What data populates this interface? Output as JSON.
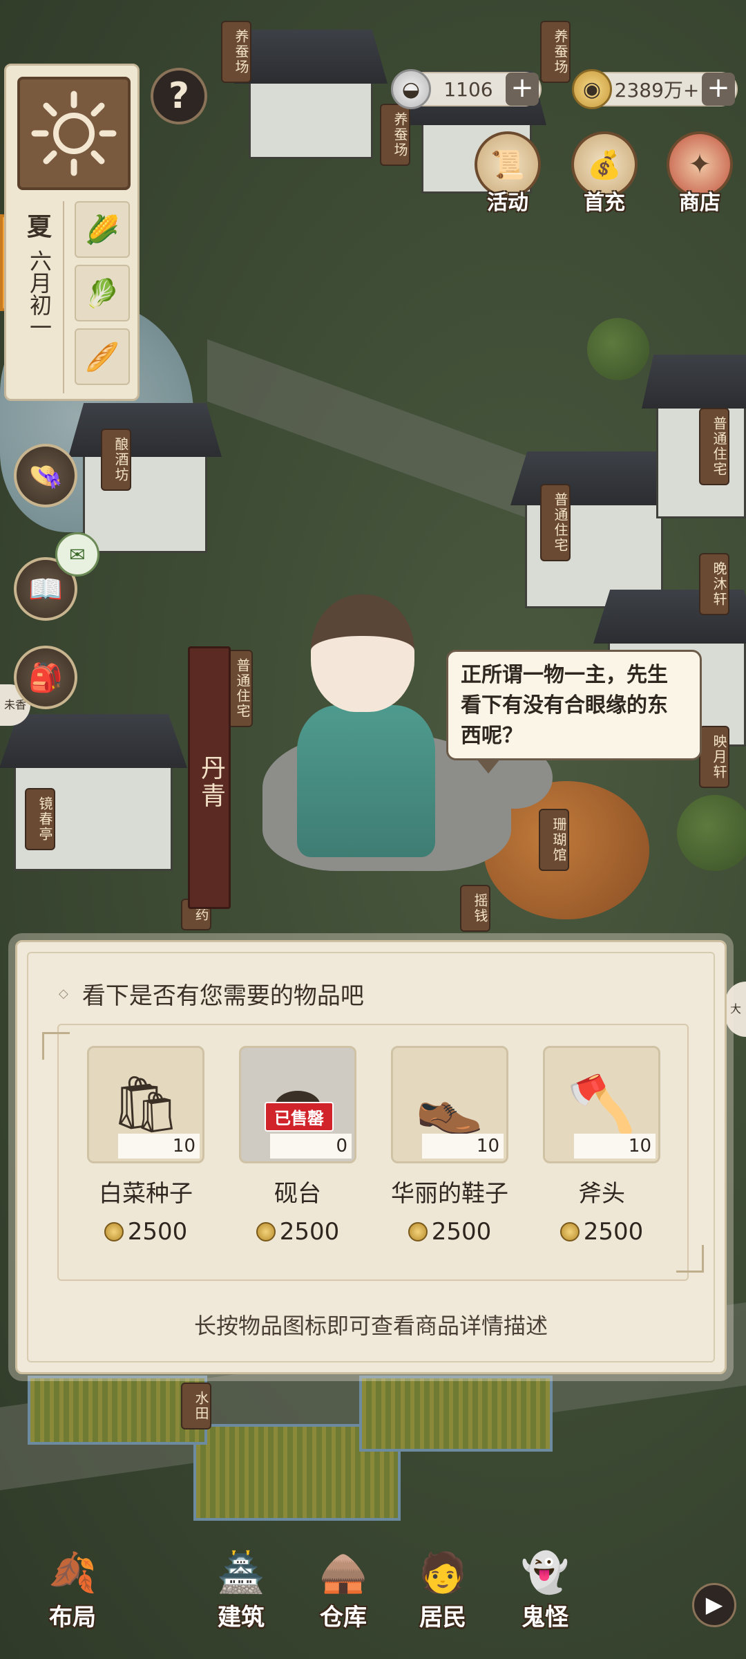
{
  "hud": {
    "season": "夏",
    "month": "六月初一",
    "silver": "1106",
    "gold": "2389万+",
    "plus": "+",
    "help": "?",
    "buttons": {
      "activity": "活动",
      "first_recharge": "首充",
      "shop": "商店"
    },
    "crop_icons": [
      "corn-icon",
      "scallion-icon",
      "bread-icon"
    ]
  },
  "buildings": {
    "silkworm_1": "养蚕场",
    "silkworm_2": "养蚕场",
    "silkworm_3": "养蚕场",
    "brewery": "酿酒坊",
    "house_1": "普通住宅",
    "house_2": "普通住宅",
    "house_3": "普通住宅",
    "wanmu": "晚沐轩",
    "yingyue": "映月轩",
    "jingchun": "镜春亭",
    "shanhu": "珊瑚馆",
    "yaoqian": "摇钱",
    "yao": "药",
    "paddy": "水田",
    "side_tag": "未香",
    "big_tag": "大"
  },
  "npc": {
    "name": "丹青",
    "speech": "正所谓一物一主，先生看下有没有合眼缘的东西呢？"
  },
  "shop": {
    "title": "看下是否有您需要的物品吧",
    "hint": "长按物品图标即可查看商品详情描述",
    "sold_label": "已售罄",
    "items": [
      {
        "name": "白菜种子",
        "count": "10",
        "price": "2500",
        "icon": "seed-bag-icon"
      },
      {
        "name": "砚台",
        "count": "0",
        "price": "2500",
        "icon": "inkstone-icon"
      },
      {
        "name": "华丽的鞋子",
        "count": "10",
        "price": "2500",
        "icon": "shoes-icon"
      },
      {
        "name": "斧头",
        "count": "10",
        "price": "2500",
        "icon": "axe-icon"
      }
    ]
  },
  "nav": {
    "layout": "布局",
    "build": "建筑",
    "storage": "仓库",
    "residents": "居民",
    "ghosts": "鬼怪",
    "more": "▶"
  },
  "colors": {
    "panel_bg": "#f0e9da",
    "accent_brown": "#6b4a34",
    "sold_red": "#d1242a",
    "orange_tab": "#f1a53c"
  }
}
